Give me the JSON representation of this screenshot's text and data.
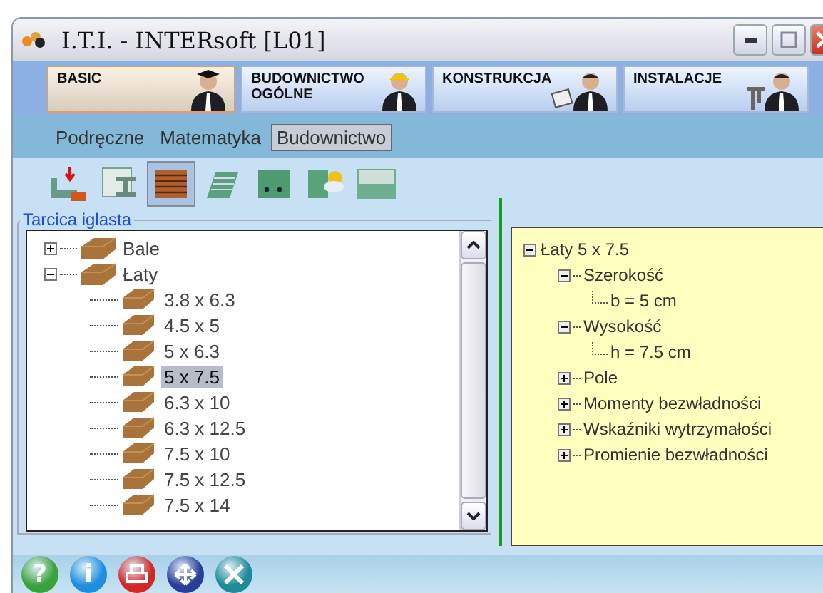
{
  "window": {
    "title": "I.T.I. - INTERsoft [L01]"
  },
  "module_tabs": [
    {
      "label": "BASIC",
      "selected": true,
      "kind": "graduate"
    },
    {
      "label": "BUDOWNICTWO\nOGÓLNE",
      "selected": false,
      "kind": "helmet"
    },
    {
      "label": "KONSTRUKCJA",
      "selected": false,
      "kind": "laptop"
    },
    {
      "label": "INSTALACJE",
      "selected": false,
      "kind": "pipe"
    }
  ],
  "menu": [
    {
      "label": "Podręczne",
      "selected": false
    },
    {
      "label": "Matematyka",
      "selected": false
    },
    {
      "label": "Budownictwo",
      "selected": true
    }
  ],
  "tools": [
    {
      "kind": "load",
      "selected": false
    },
    {
      "kind": "ibeam",
      "selected": false
    },
    {
      "kind": "timber",
      "selected": true
    },
    {
      "kind": "stairs",
      "selected": false
    },
    {
      "kind": "bolt",
      "selected": false
    },
    {
      "kind": "wall",
      "selected": false
    },
    {
      "kind": "soil",
      "selected": false
    }
  ],
  "group": {
    "title": "Tarcica iglasta"
  },
  "tree": [
    {
      "label": "Bale",
      "expanded": false
    },
    {
      "label": "Łaty",
      "expanded": true,
      "children": [
        {
          "label": "3.8 x 6.3",
          "selected": false
        },
        {
          "label": "4.5 x 5",
          "selected": false
        },
        {
          "label": "5 x 6.3",
          "selected": false
        },
        {
          "label": "5 x 7.5",
          "selected": true
        },
        {
          "label": "6.3 x 10",
          "selected": false
        },
        {
          "label": "6.3 x 12.5",
          "selected": false
        },
        {
          "label": "7.5 x 10",
          "selected": false
        },
        {
          "label": "7.5 x 12.5",
          "selected": false
        },
        {
          "label": "7.5 x 14",
          "selected": false
        }
      ]
    }
  ],
  "details": {
    "label": "Łaty 5 x 7.5",
    "expanded": true,
    "children": [
      {
        "label": "Szerokość",
        "expanded": true,
        "children": [
          {
            "label": "b = 5 cm"
          }
        ]
      },
      {
        "label": "Wysokość",
        "expanded": true,
        "children": [
          {
            "label": "h = 7.5 cm"
          }
        ]
      },
      {
        "label": "Pole",
        "expanded": false
      },
      {
        "label": "Momenty bezwładności",
        "expanded": false
      },
      {
        "label": "Wskaźniki wytrzymałości",
        "expanded": false
      },
      {
        "label": "Promienie bezwładności",
        "expanded": false
      }
    ]
  },
  "bottom_buttons": [
    {
      "kind": "help",
      "glyph": "?"
    },
    {
      "kind": "info",
      "glyph": "i"
    },
    {
      "kind": "print"
    },
    {
      "kind": "network"
    },
    {
      "kind": "tools"
    }
  ]
}
